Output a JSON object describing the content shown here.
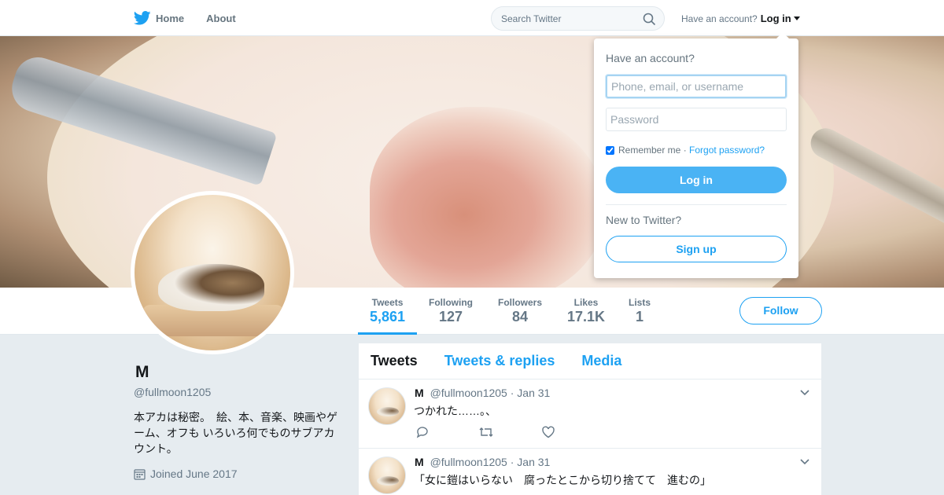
{
  "colors": {
    "accent": "#1da1f2",
    "login_button": "#4ab3f4",
    "text": "#14171a",
    "muted": "#657786"
  },
  "nav": {
    "home_label": "Home",
    "about_label": "About",
    "search_placeholder": "Search Twitter",
    "account_prompt": "Have an account?",
    "login_label": "Log in"
  },
  "stats": [
    {
      "label": "Tweets",
      "value": "5,861"
    },
    {
      "label": "Following",
      "value": "127"
    },
    {
      "label": "Followers",
      "value": "84"
    },
    {
      "label": "Likes",
      "value": "17.1K"
    },
    {
      "label": "Lists",
      "value": "1"
    }
  ],
  "follow_label": "Follow",
  "profile": {
    "name": "M",
    "handle": "@fullmoon1205",
    "bio": "本アカは秘密。　絵、本、音楽、映画やゲーム、オフも いろいろ何でものサブアカウント。",
    "joined": "Joined June 2017"
  },
  "tabs": [
    "Tweets",
    "Tweets & replies",
    "Media"
  ],
  "tweets": [
    {
      "name": "M",
      "handle": "@fullmoon1205",
      "date": "· Jan 31",
      "text": "つかれた……。、"
    },
    {
      "name": "M",
      "handle": "@fullmoon1205",
      "date": "· Jan 31",
      "text": "「女に鎧はいらない　腐ったとこから切り捨てて　進むの」"
    }
  ],
  "login_dropdown": {
    "title": "Have an account?",
    "username_placeholder": "Phone, email, or username",
    "password_placeholder": "Password",
    "remember_label": "Remember me",
    "separator": " · ",
    "forgot_label": "Forgot password?",
    "login_button": "Log in",
    "new_prompt": "New to Twitter?",
    "signup_button": "Sign up"
  }
}
